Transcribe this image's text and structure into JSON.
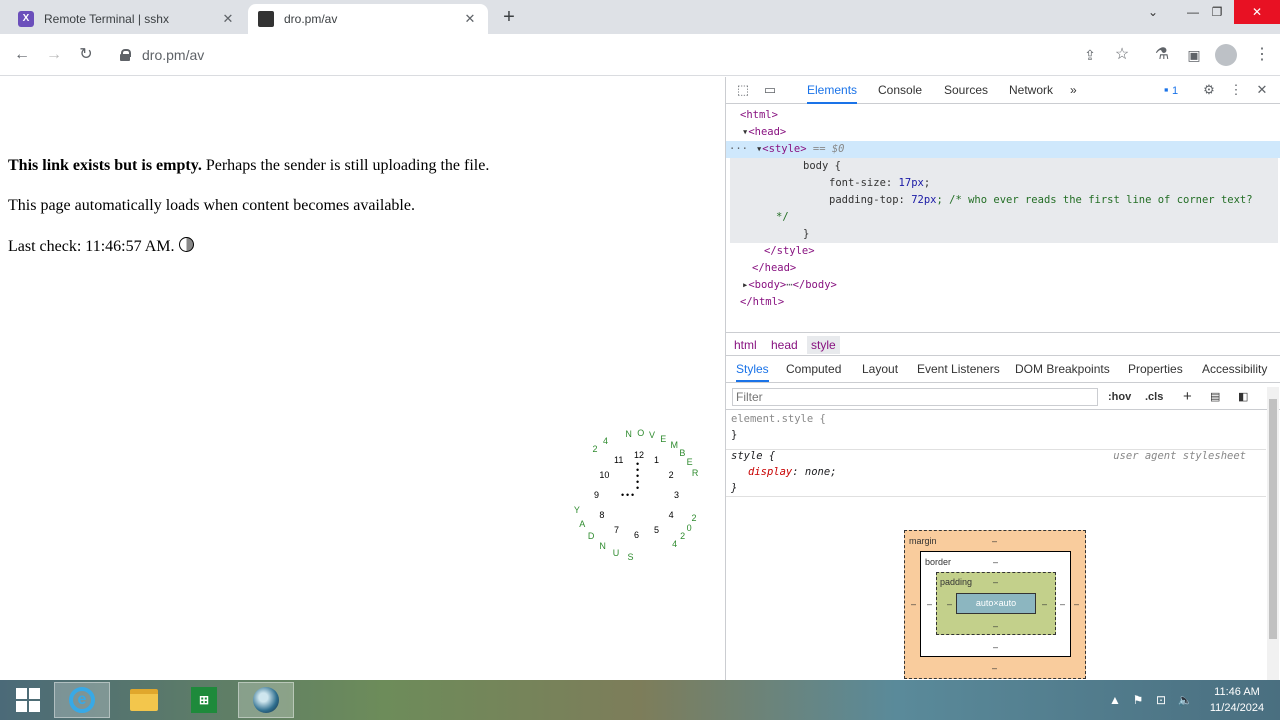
{
  "browser": {
    "tabs": [
      {
        "title": "Remote Terminal | sshx",
        "favicon": "x-logo-icon",
        "active": false
      },
      {
        "title": "dro.pm/av",
        "favicon": "site-icon",
        "active": true
      }
    ],
    "url": "dro.pm/av"
  },
  "page": {
    "p1_bold": "This link exists but is empty.",
    "p1_rest": " Perhaps the sender is still uploading the file.",
    "p2": "This page automatically loads when content becomes available.",
    "p3": "Last check: 11:46:57 AM.",
    "clock": {
      "numbers": [
        "12",
        "1",
        "2",
        "3",
        "4",
        "5",
        "6",
        "7",
        "8",
        "9",
        "10",
        "11"
      ],
      "ring_month": [
        "N",
        "O",
        "V",
        "E",
        "M",
        "B",
        "E",
        "R"
      ],
      "ring_year": [
        "2",
        "0",
        "2",
        "4"
      ],
      "ring_day": [
        "S",
        "U",
        "N",
        "D",
        "A",
        "Y"
      ],
      "ring_date": [
        "2",
        "4"
      ]
    }
  },
  "devtools": {
    "tabs": [
      "Elements",
      "Console",
      "Sources",
      "Network"
    ],
    "more": "»",
    "issues_count": "1",
    "dom": {
      "l1": "<html>",
      "l2": "<head>",
      "l3_tag": "<style>",
      "l3_eq": " == $0",
      "l4": "body {",
      "l5_prop": "font-size: ",
      "l5_val": "17px",
      "l5_end": ";",
      "l6_prop": "padding-top: ",
      "l6_val": "72px",
      "l6_end": "; /* who ever reads the first line of corner text?",
      "l7": "*/",
      "l8": "}",
      "l9": "</style>",
      "l10": "</head>",
      "l11_open": "<body>",
      "l11_dots": "⋯",
      "l11_close": "</body>",
      "l12": "</html>"
    },
    "breadcrumbs": [
      "html",
      "head",
      "style"
    ],
    "style_tabs": [
      "Styles",
      "Computed",
      "Layout",
      "Event Listeners",
      "DOM Breakpoints",
      "Properties",
      "Accessibility"
    ],
    "filter_placeholder": "Filter",
    "filter_tools": [
      ":hov",
      ".cls"
    ],
    "rules": {
      "element_style": "element.style {",
      "close1": "}",
      "style_sel": "style {",
      "ua": "user agent stylesheet",
      "prop": "display",
      "val": ": none;",
      "close2": "}"
    },
    "box_model": {
      "margin_label": "margin",
      "border_label": "border",
      "padding_label": "padding",
      "content": "auto×auto",
      "dash": "–"
    }
  },
  "taskbar": {
    "time": "11:46 AM",
    "date": "11/24/2024"
  },
  "colors": {
    "accent": "#1a73e8",
    "tag": "#881280",
    "comment": "#236e25"
  }
}
